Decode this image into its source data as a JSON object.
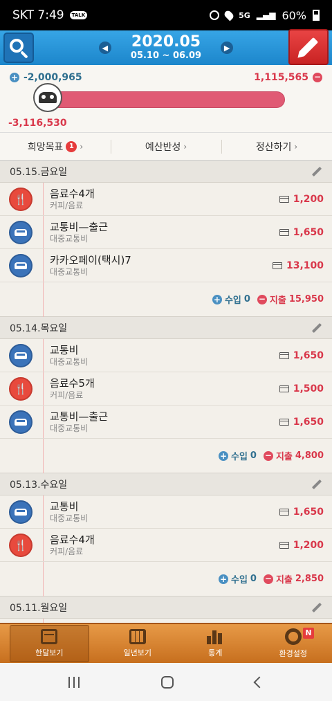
{
  "status": {
    "carrier_time": "SKT 7:49",
    "talk": "TALK",
    "network": "5G",
    "battery": "60%"
  },
  "header": {
    "month": "2020.05",
    "range": "05.10 ~ 06.09"
  },
  "budget": {
    "income_total": "-2,000,965",
    "expense_total": "1,115,565",
    "balance": "-3,116,530",
    "bar_fill_percent": 100
  },
  "subtabs": [
    {
      "label": "희망목표",
      "badge": "1"
    },
    {
      "label": "예산반성"
    },
    {
      "label": "정산하기"
    }
  ],
  "days": [
    {
      "date": "05.15.금요일",
      "items": [
        {
          "title": "음료수4개",
          "category": "커피/음료",
          "amount": "1,200",
          "icon": "food-icon"
        },
        {
          "title": "교통비—출근",
          "category": "대중교통비",
          "amount": "1,650",
          "icon": "car-icon"
        },
        {
          "title": "카카오페이(택시)7",
          "category": "대중교통비",
          "amount": "13,100",
          "icon": "car-icon"
        }
      ],
      "income_label": "수입",
      "income": "0",
      "expense_label": "지출",
      "expense": "15,950"
    },
    {
      "date": "05.14.목요일",
      "items": [
        {
          "title": "교통비",
          "category": "대중교통비",
          "amount": "1,650",
          "icon": "car-icon"
        },
        {
          "title": "음료수5개",
          "category": "커피/음료",
          "amount": "1,500",
          "icon": "food-icon"
        },
        {
          "title": "교통비—출근",
          "category": "대중교통비",
          "amount": "1,650",
          "icon": "car-icon"
        }
      ],
      "income_label": "수입",
      "income": "0",
      "expense_label": "지출",
      "expense": "4,800"
    },
    {
      "date": "05.13.수요일",
      "items": [
        {
          "title": "교통비",
          "category": "대중교통비",
          "amount": "1,650",
          "icon": "car-icon"
        },
        {
          "title": "음료수4개",
          "category": "커피/음료",
          "amount": "1,200",
          "icon": "food-icon"
        }
      ],
      "income_label": "수입",
      "income": "0",
      "expense_label": "지출",
      "expense": "2,850"
    },
    {
      "date": "05.11.월요일",
      "items": []
    }
  ],
  "tabbar": [
    {
      "label": "한달보기",
      "active": true
    },
    {
      "label": "일년보기"
    },
    {
      "label": "통계"
    },
    {
      "label": "환경설정",
      "badge": "N"
    }
  ]
}
